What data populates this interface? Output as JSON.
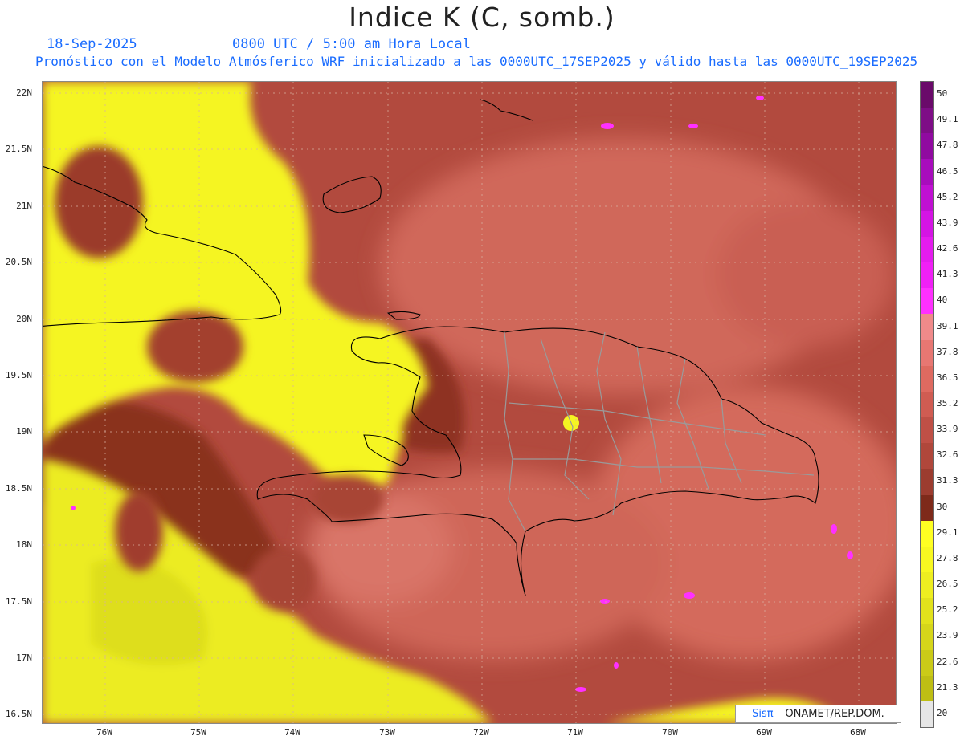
{
  "header": {
    "title": "Indice K (C, somb.)",
    "date": "18-Sep-2025",
    "time": "0800 UTC / 5:00 am Hora Local",
    "model_info": "Pronóstico con el Modelo Atmósferico WRF inicializado a las 0000UTC_17SEP2025 y válido hasta las  0000UTC_19SEP2025"
  },
  "axes": {
    "lat_labels": [
      "22N",
      "21.5N",
      "21N",
      "20.5N",
      "20N",
      "19.5N",
      "19N",
      "18.5N",
      "18N",
      "17.5N",
      "17N",
      "16.5N"
    ],
    "lon_labels": [
      "76W",
      "75W",
      "74W",
      "73W",
      "72W",
      "71W",
      "70W",
      "69W",
      "68W"
    ]
  },
  "colorbar": {
    "labels": [
      "50",
      "49.1",
      "47.8",
      "46.5",
      "45.2",
      "43.9",
      "42.6",
      "41.3",
      "40",
      "39.1",
      "37.8",
      "36.5",
      "35.2",
      "33.9",
      "32.6",
      "31.3",
      "30",
      "29.1",
      "27.8",
      "26.5",
      "25.2",
      "23.9",
      "22.6",
      "21.3",
      "20"
    ],
    "colors": [
      "#6a0a6a",
      "#7e0d86",
      "#900aa0",
      "#a80cbc",
      "#c010d2",
      "#d414e4",
      "#e41cee",
      "#f020f6",
      "#ff30ff",
      "#f08a8a",
      "#e77772",
      "#de6a60",
      "#d05c52",
      "#bf5046",
      "#b0473b",
      "#9c3c2f",
      "#7e2a1a",
      "#ffff22",
      "#f8f820",
      "#eeee20",
      "#e2e21c",
      "#d6d61a",
      "#caca18",
      "#bebe14",
      "#e6e6e6"
    ]
  },
  "credit": {
    "brand": "Sisπ",
    "org": "– ONAMET/REP.DOM."
  },
  "colors": {
    "accent_text": "#1a6cff",
    "ocean_low": "#f5f522",
    "high_k": "#c25a4c",
    "coastline": "#000000",
    "province_lines": "#9a9a9a"
  }
}
